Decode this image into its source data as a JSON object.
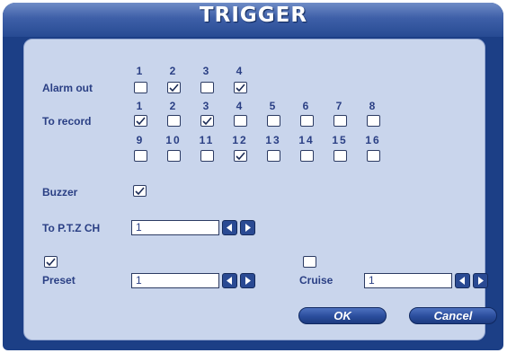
{
  "title": "TRIGGER",
  "alarm_out": {
    "label": "Alarm out",
    "numbers": [
      "1",
      "2",
      "3",
      "4"
    ],
    "checked": [
      false,
      true,
      false,
      true
    ]
  },
  "to_record": {
    "label": "To record",
    "numbers_row1": [
      "1",
      "2",
      "3",
      "4",
      "5",
      "6",
      "7",
      "8"
    ],
    "checked_row1": [
      true,
      false,
      true,
      false,
      false,
      false,
      false,
      false
    ],
    "numbers_row2": [
      "9",
      "10",
      "11",
      "12",
      "13",
      "14",
      "15",
      "16"
    ],
    "checked_row2": [
      false,
      false,
      false,
      true,
      false,
      false,
      false,
      false
    ]
  },
  "buzzer": {
    "label": "Buzzer",
    "checked": true
  },
  "to_ptz": {
    "label": "To P.T.Z CH",
    "value": "1"
  },
  "preset": {
    "label": "Preset",
    "checked": true,
    "value": "1"
  },
  "cruise": {
    "label": "Cruise",
    "checked": false,
    "value": "1"
  },
  "buttons": {
    "ok": "OK",
    "cancel": "Cancel"
  },
  "colors": {
    "frame": "#1c3f86",
    "panel": "#c9d5ec",
    "label": "#2a3f84"
  }
}
